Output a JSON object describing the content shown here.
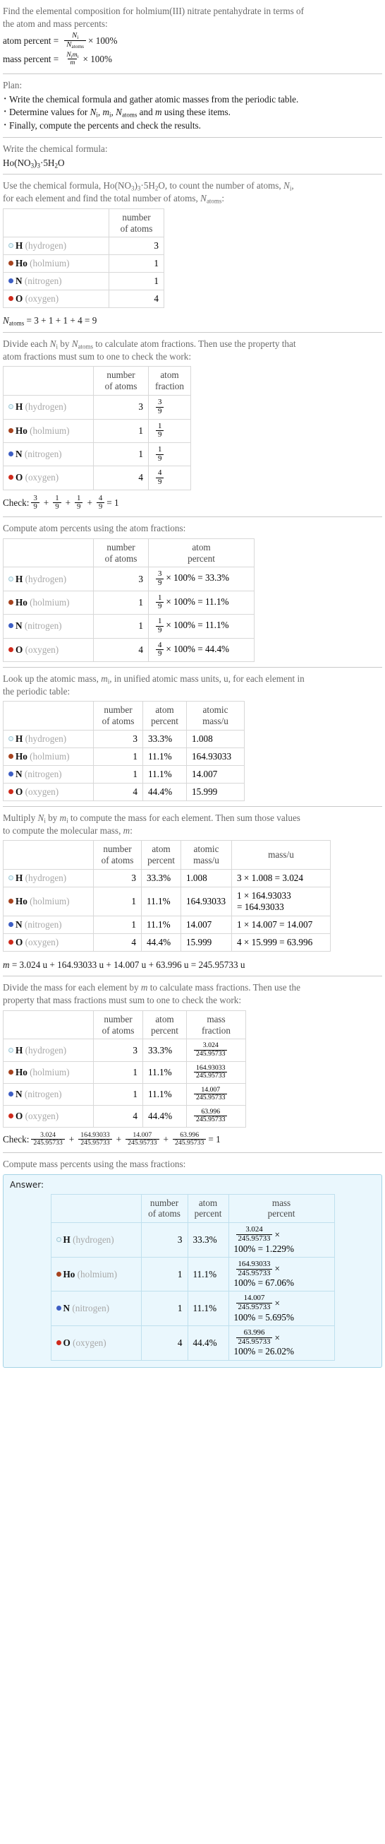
{
  "intro": {
    "line1": "Find the elemental composition for holmium(III) nitrate pentahydrate in terms of",
    "line2": "the atom and mass percents:",
    "atom_percent_label": "atom percent =",
    "atom_percent_num": "N",
    "atom_percent_num_sub": "i",
    "atom_percent_den": "N",
    "atom_percent_den_sub": "atoms",
    "atom_percent_tail": "× 100%",
    "mass_percent_label": "mass percent =",
    "mass_percent_num": "N",
    "mass_percent_num_sub": "i",
    "mass_percent_num2": "m",
    "mass_percent_num2_sub": "i",
    "mass_percent_den": "m",
    "mass_percent_tail": "× 100%"
  },
  "plan": {
    "title": "Plan:",
    "items": [
      "Write the chemical formula and gather atomic masses from the periodic table.",
      "Determine values for Nᵢ, mᵢ, N_atoms and m using these items.",
      "Finally, compute the percents and check the results."
    ],
    "item2_parts": {
      "pre": "Determine values for ",
      "mid": " and ",
      "post": " using these items."
    }
  },
  "formula_section": {
    "title": "Write the chemical formula:",
    "formula_plain": "Ho(NO3)3·5H2O"
  },
  "count_section": {
    "line1_pre": "Use the chemical formula, ",
    "line1_post": ", to count the number of atoms, ",
    "line1_sym": "N",
    "line1_sym_sub": "i",
    "line1_end": ",",
    "line2_pre": "for each element and find the total number of atoms, ",
    "line2_sym": "N",
    "line2_sym_sub": "atoms",
    "line2_end": ":",
    "headers": [
      "",
      "number of atoms"
    ],
    "total_label": "N",
    "total_label_sub": "atoms",
    "total_expr": "= 3 + 1 + 1 + 4 = 9"
  },
  "elements": [
    {
      "symbol": "H",
      "name": "(hydrogen)",
      "color": "#e8f6fa",
      "border": "#9ec6d4",
      "count": "3",
      "frac_num": "3",
      "frac_den": "9",
      "atom_percent": "33.3%",
      "atomic_mass": "1.008",
      "mass_expr": "3 × 1.008 = 3.024",
      "mass_expr_line1": "3 × 1.008 = 3.024",
      "mass_expr_line2": "",
      "mass_num": "3.024",
      "mass_percent_result": "100% = 1.229%"
    },
    {
      "symbol": "Ho",
      "name": "(holmium)",
      "color": "#a6431f",
      "border": "#a6431f",
      "count": "1",
      "frac_num": "1",
      "frac_den": "9",
      "atom_percent": "11.1%",
      "atomic_mass": "164.93033",
      "mass_expr": "1 × 164.93033 = 164.93033",
      "mass_expr_line1": "1 × 164.93033",
      "mass_expr_line2": "= 164.93033",
      "mass_num": "164.93033",
      "mass_percent_result": "100% = 67.06%"
    },
    {
      "symbol": "N",
      "name": "(nitrogen)",
      "color": "#3d5ec4",
      "border": "#3d5ec4",
      "count": "1",
      "frac_num": "1",
      "frac_den": "9",
      "atom_percent": "11.1%",
      "atomic_mass": "14.007",
      "mass_expr": "1 × 14.007 = 14.007",
      "mass_expr_line1": "1 × 14.007 = 14.007",
      "mass_expr_line2": "",
      "mass_num": "14.007",
      "mass_percent_result": "100% = 5.695%"
    },
    {
      "symbol": "O",
      "name": "(oxygen)",
      "color": "#cf2a1c",
      "border": "#cf2a1c",
      "count": "4",
      "frac_num": "4",
      "frac_den": "9",
      "atom_percent": "44.4%",
      "atomic_mass": "15.999",
      "mass_expr": "4 × 15.999 = 63.996",
      "mass_expr_line1": "4 × 15.999 = 63.996",
      "mass_expr_line2": "",
      "mass_num": "63.996",
      "mass_percent_result": "100% = 26.02%"
    }
  ],
  "atom_fraction_section": {
    "line1_pre": "Divide each ",
    "line1_mid": " by ",
    "line1_post": " to calculate atom fractions. Then use the property that",
    "line2": "atom fractions must sum to one to check the work:",
    "headers": [
      "",
      "number of atoms",
      "atom fraction"
    ],
    "check_label": "Check:",
    "check_result": "= 1"
  },
  "atom_percent_section": {
    "lead": "Compute atom percents using the atom fractions:",
    "headers": [
      "",
      "number of atoms",
      "atom percent"
    ],
    "times_100": "× 100% ="
  },
  "atomic_mass_section": {
    "line1_pre": "Look up the atomic mass, ",
    "line1_sym": "m",
    "line1_sym_sub": "i",
    "line1_post": ", in unified atomic mass units, u, for each element in",
    "line2": "the periodic table:",
    "headers": [
      "",
      "number of atoms",
      "atom percent",
      "atomic mass/u"
    ]
  },
  "molecular_mass_section": {
    "line1_pre": "Multiply ",
    "line1_mid": " by ",
    "line1_post": " to compute the mass for each element. Then sum those values",
    "line2_pre": "to compute the molecular mass, ",
    "line2_sym": "m",
    "line2_post": ":",
    "headers": [
      "",
      "number of atoms",
      "atom percent",
      "atomic mass/u",
      "mass/u"
    ],
    "result_sym": "m",
    "result": "= 3.024 u + 164.93033 u + 14.007 u + 63.996 u = 245.95733 u"
  },
  "mass_fraction_section": {
    "line1_pre": "Divide the mass for each element by ",
    "line1_sym": "m",
    "line1_post": " to calculate mass fractions. Then use the",
    "line2": "property that mass fractions must sum to one to check the work:",
    "headers": [
      "",
      "number of atoms",
      "atom percent",
      "mass fraction"
    ],
    "denominator": "245.95733",
    "check_label": "Check:",
    "check_result": "= 1"
  },
  "mass_percent_section": {
    "lead": "Compute mass percents using the mass fractions:",
    "answer_label": "Answer:",
    "headers": [
      "",
      "number of atoms",
      "atom percent",
      "mass percent"
    ],
    "denominator": "245.95733",
    "times": "×"
  }
}
